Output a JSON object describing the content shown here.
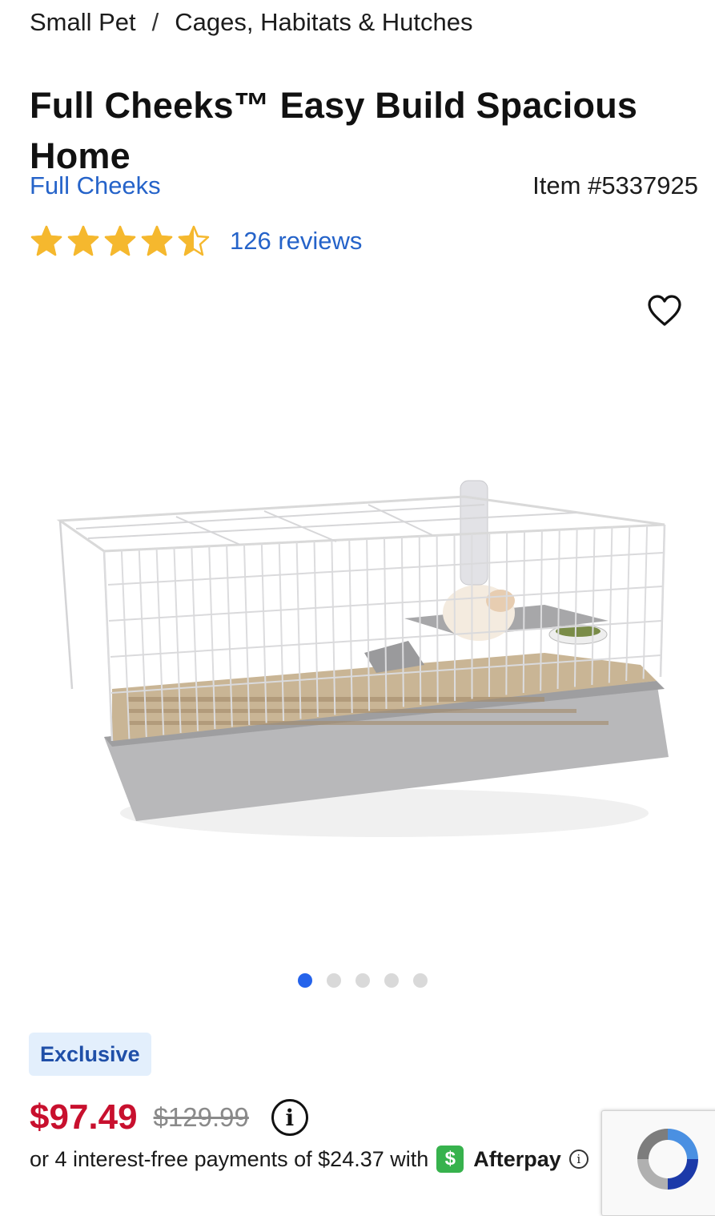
{
  "breadcrumb": {
    "items": [
      "Small Pet",
      "Cages, Habitats & Hutches"
    ],
    "separator": "/"
  },
  "product": {
    "title": "Full Cheeks™ Easy Build Spacious Home",
    "brand": "Full Cheeks",
    "item_number": "Item #5337925",
    "rating_value": 4.5,
    "rating_max": 5,
    "reviews_label": "126 reviews",
    "badge": "Exclusive",
    "sale_price": "$97.49",
    "original_price": "$129.99"
  },
  "gallery": {
    "total_images": 5,
    "active_index": 0
  },
  "installments": {
    "text": "or 4 interest-free payments of $24.37 with",
    "provider_icon": "$",
    "provider_name": "Afterpay"
  },
  "icons": {
    "favorite": "heart-outline-icon",
    "price_info": "info-icon",
    "afterpay_info": "info-icon",
    "star": "star-icon"
  },
  "colors": {
    "link": "#2563c9",
    "price": "#c8102e",
    "star": "#f5b82e",
    "dot_active": "#2563eb",
    "badge_bg": "#e3effc",
    "badge_text": "#1f4fa8",
    "afterpay": "#37b24d"
  }
}
